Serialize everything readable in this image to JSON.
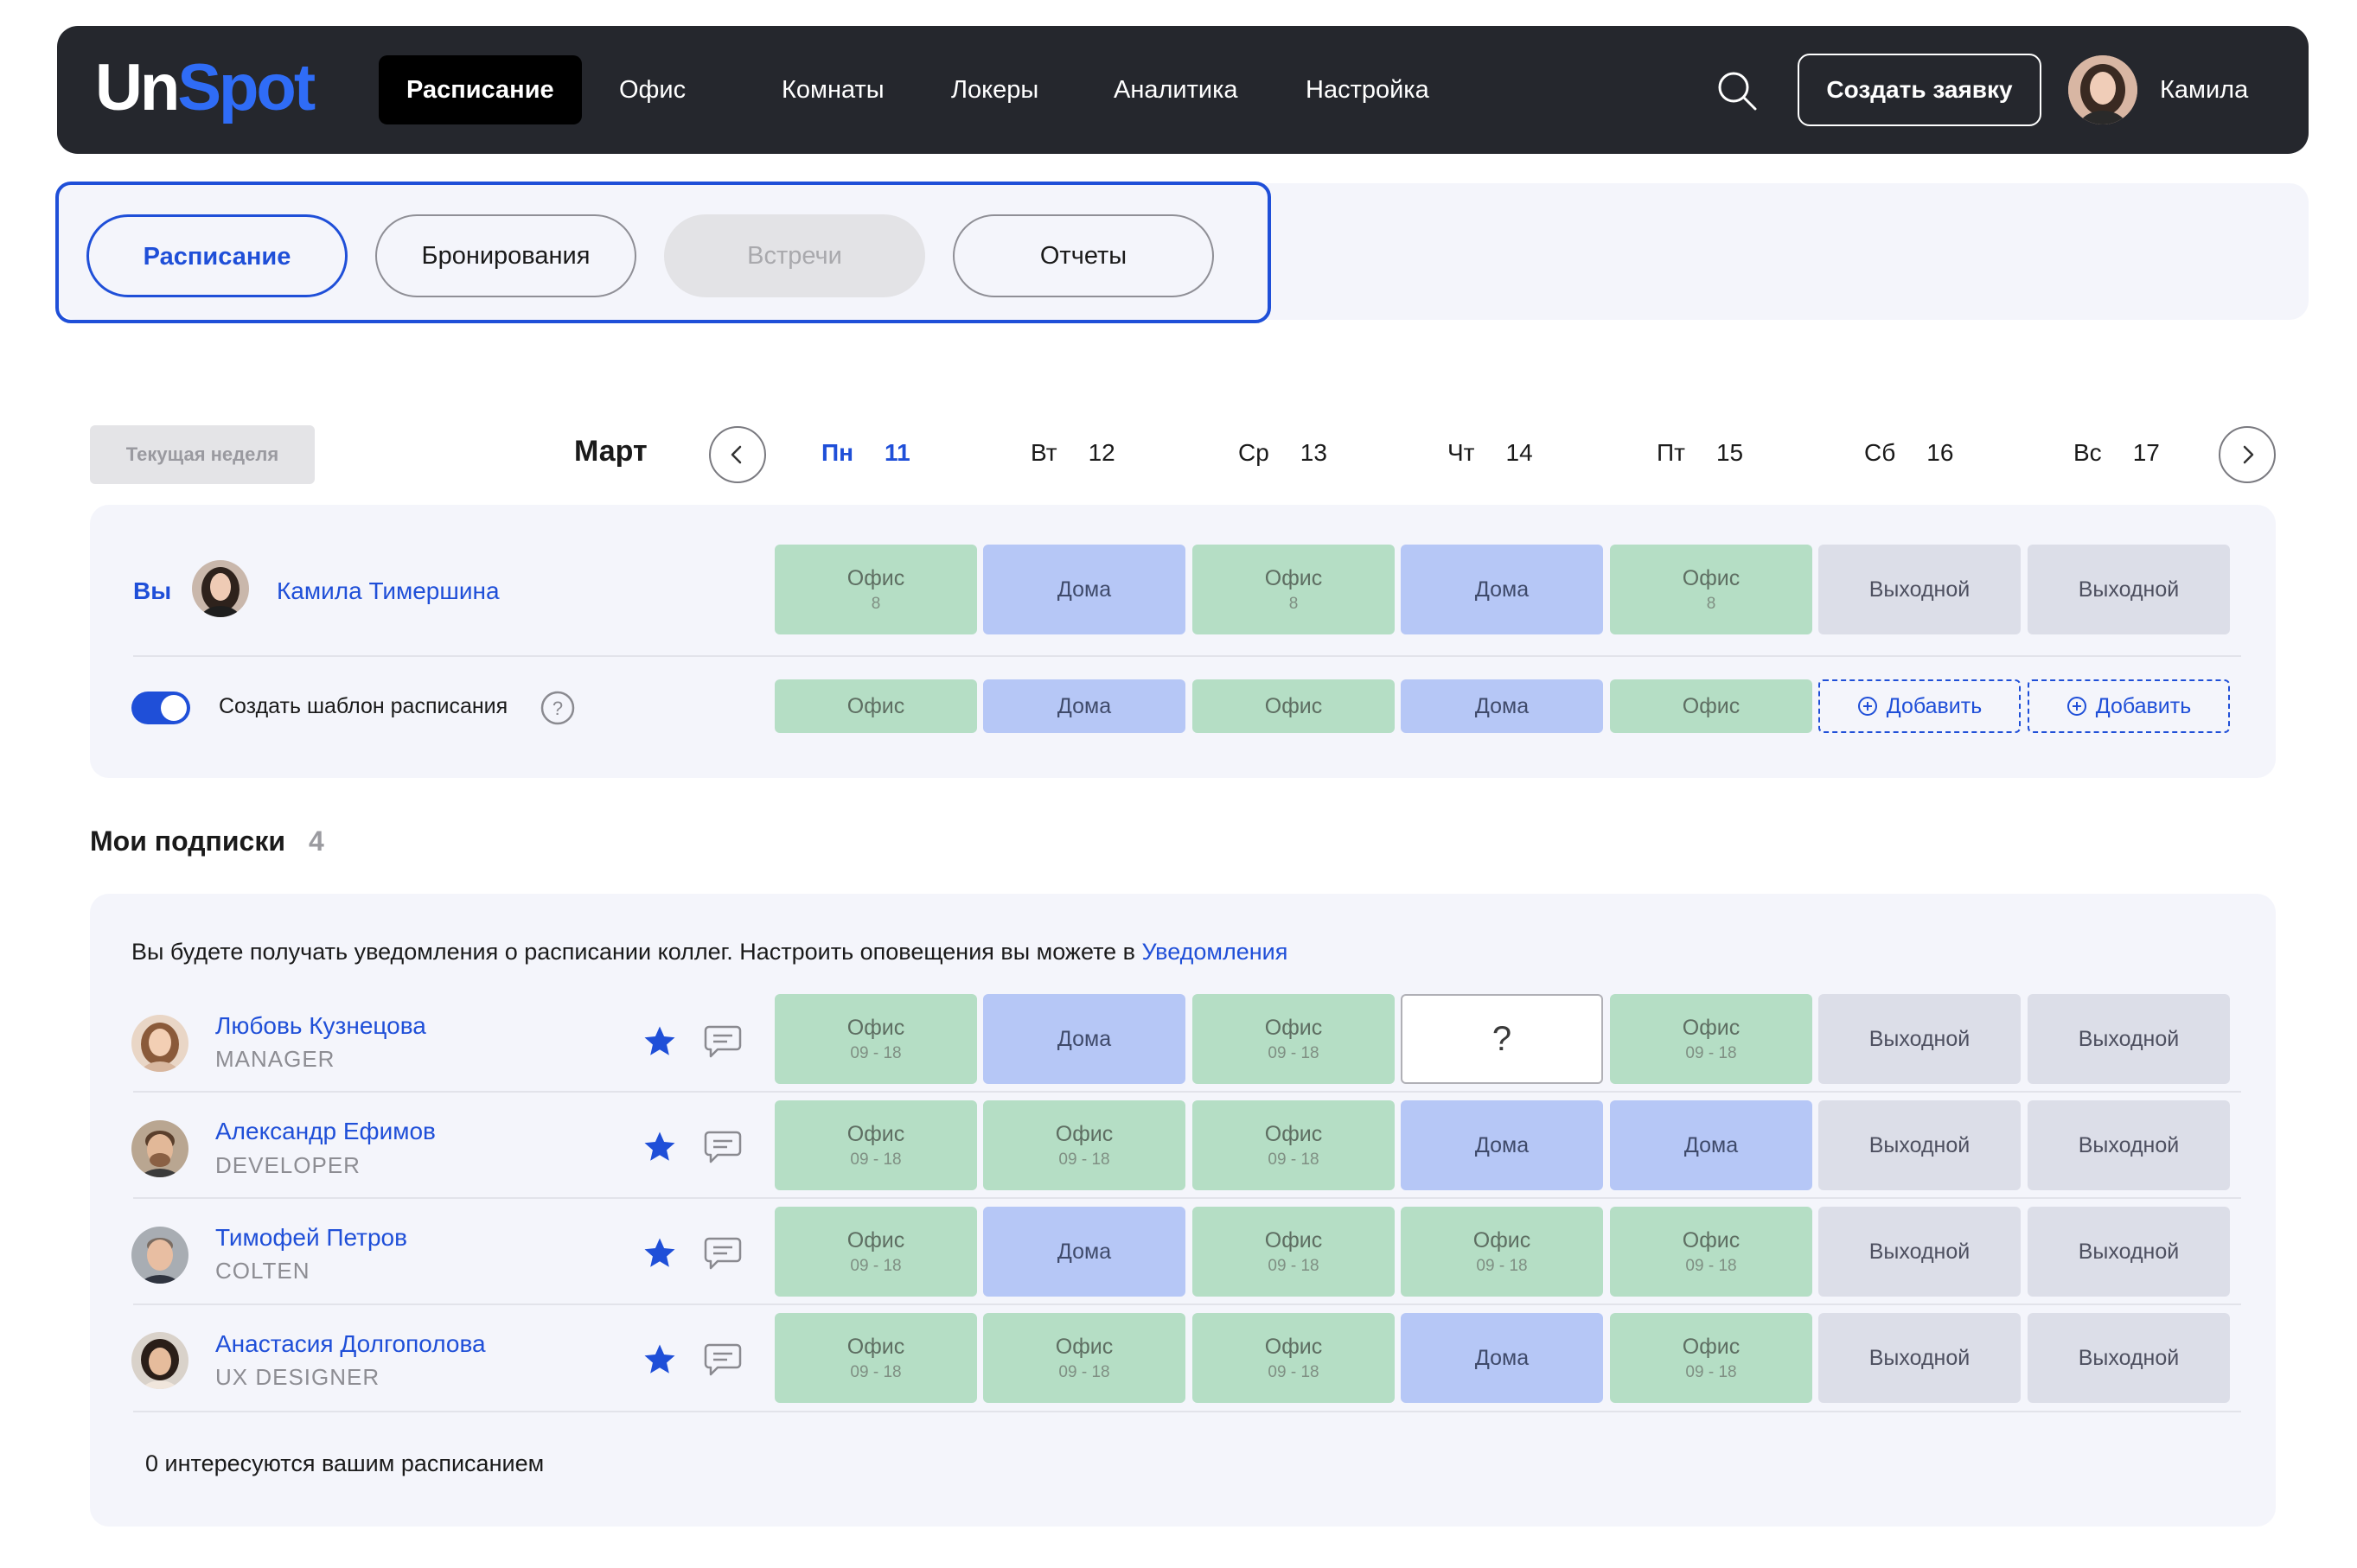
{
  "navbar": {
    "logo": {
      "part1": "Un",
      "part2": "Spot"
    },
    "items": [
      "Расписание",
      "Офис",
      "Комнаты",
      "Локеры",
      "Аналитика",
      "Настройка"
    ],
    "active_index": 0,
    "create_button": "Создать заявку",
    "user_name": "Камила"
  },
  "subtabs": {
    "items": [
      "Расписание",
      "Бронирования",
      "Встречи",
      "Отчеты"
    ],
    "active_index": 0,
    "disabled_index": 2
  },
  "week": {
    "current_week_button": "Текущая неделя",
    "month": "Март",
    "days": [
      {
        "name": "Пн",
        "num": "11"
      },
      {
        "name": "Вт",
        "num": "12"
      },
      {
        "name": "Ср",
        "num": "13"
      },
      {
        "name": "Чт",
        "num": "14"
      },
      {
        "name": "Пт",
        "num": "15"
      },
      {
        "name": "Сб",
        "num": "16"
      },
      {
        "name": "Вс",
        "num": "17"
      }
    ],
    "today_index": 0
  },
  "you": {
    "label": "Вы",
    "name": "Камила Тимершина",
    "schedule": [
      {
        "type": "office",
        "label": "Офис",
        "sub": "8"
      },
      {
        "type": "home",
        "label": "Дома",
        "sub": ""
      },
      {
        "type": "office",
        "label": "Офис",
        "sub": "8"
      },
      {
        "type": "home",
        "label": "Дома",
        "sub": ""
      },
      {
        "type": "office",
        "label": "Офис",
        "sub": "8"
      },
      {
        "type": "off",
        "label": "Выходной",
        "sub": ""
      },
      {
        "type": "off",
        "label": "Выходной",
        "sub": ""
      }
    ],
    "template_label": "Создать шаблон расписания",
    "template_enabled": true,
    "template": [
      {
        "type": "office",
        "label": "Офис"
      },
      {
        "type": "home",
        "label": "Дома"
      },
      {
        "type": "office",
        "label": "Офис"
      },
      {
        "type": "home",
        "label": "Дома"
      },
      {
        "type": "office",
        "label": "Офис"
      },
      {
        "type": "add",
        "label": "Добавить"
      },
      {
        "type": "add",
        "label": "Добавить"
      }
    ]
  },
  "subscriptions": {
    "title": "Мои подписки",
    "count": "4",
    "notice_text": "Вы будете получать уведомления о расписании коллег. Настроить оповещения вы можете в ",
    "notice_link": "Уведомления",
    "people": [
      {
        "name": "Любовь Кузнецова",
        "role": "MANAGER",
        "schedule": [
          {
            "type": "office",
            "label": "Офис",
            "sub": "09 - 18"
          },
          {
            "type": "home",
            "label": "Дома",
            "sub": ""
          },
          {
            "type": "office",
            "label": "Офис",
            "sub": "09 - 18"
          },
          {
            "type": "unknown",
            "label": "?",
            "sub": ""
          },
          {
            "type": "office",
            "label": "Офис",
            "sub": "09 - 18"
          },
          {
            "type": "off",
            "label": "Выходной",
            "sub": ""
          },
          {
            "type": "off",
            "label": "Выходной",
            "sub": ""
          }
        ]
      },
      {
        "name": "Александр Ефимов",
        "role": "DEVELOPER",
        "schedule": [
          {
            "type": "office",
            "label": "Офис",
            "sub": "09 - 18"
          },
          {
            "type": "office",
            "label": "Офис",
            "sub": "09 - 18"
          },
          {
            "type": "office",
            "label": "Офис",
            "sub": "09 - 18"
          },
          {
            "type": "home",
            "label": "Дома",
            "sub": ""
          },
          {
            "type": "home",
            "label": "Дома",
            "sub": ""
          },
          {
            "type": "off",
            "label": "Выходной",
            "sub": ""
          },
          {
            "type": "off",
            "label": "Выходной",
            "sub": ""
          }
        ]
      },
      {
        "name": "Тимофей Петров",
        "role": "COLTEN",
        "schedule": [
          {
            "type": "office",
            "label": "Офис",
            "sub": "09 - 18"
          },
          {
            "type": "home",
            "label": "Дома",
            "sub": ""
          },
          {
            "type": "office",
            "label": "Офис",
            "sub": "09 - 18"
          },
          {
            "type": "office",
            "label": "Офис",
            "sub": "09 - 18"
          },
          {
            "type": "office",
            "label": "Офис",
            "sub": "09 - 18"
          },
          {
            "type": "off",
            "label": "Выходной",
            "sub": ""
          },
          {
            "type": "off",
            "label": "Выходной",
            "sub": ""
          }
        ]
      },
      {
        "name": "Анастасия Долгополова",
        "role": "UX DESIGNER",
        "schedule": [
          {
            "type": "office",
            "label": "Офис",
            "sub": "09 - 18"
          },
          {
            "type": "office",
            "label": "Офис",
            "sub": "09 - 18"
          },
          {
            "type": "office",
            "label": "Офис",
            "sub": "09 - 18"
          },
          {
            "type": "home",
            "label": "Дома",
            "sub": ""
          },
          {
            "type": "office",
            "label": "Офис",
            "sub": "09 - 18"
          },
          {
            "type": "off",
            "label": "Выходной",
            "sub": ""
          },
          {
            "type": "off",
            "label": "Выходной",
            "sub": ""
          }
        ]
      }
    ],
    "footer": "0 интересуются вашим расписанием"
  },
  "colors": {
    "accent": "#1f4fd8",
    "navbar": "#25272d",
    "office": "#b5dec5",
    "home": "#b6c7f6",
    "off": "#dcdee8"
  },
  "icons": [
    "search-icon",
    "chevron-left-icon",
    "chevron-right-icon",
    "help-icon",
    "star-icon",
    "chat-icon",
    "plus-circle-icon"
  ]
}
